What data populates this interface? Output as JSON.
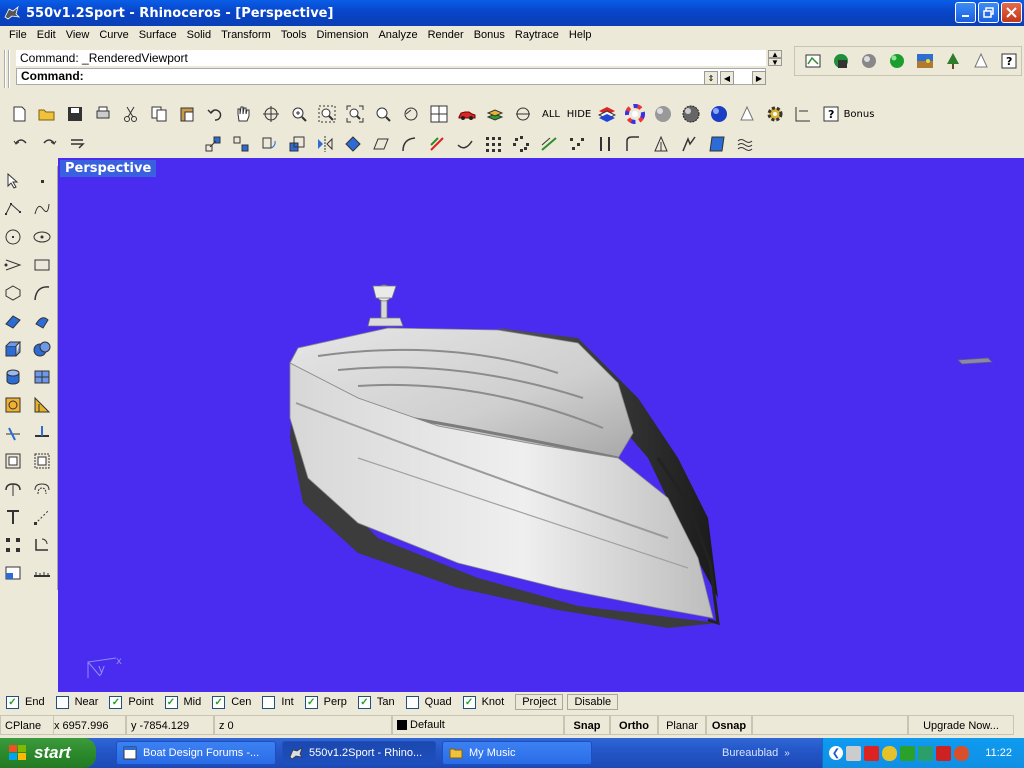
{
  "window": {
    "title": "550v1.2Sport - Rhinoceros - [Perspective]"
  },
  "menu": [
    "File",
    "Edit",
    "View",
    "Curve",
    "Surface",
    "Solid",
    "Transform",
    "Tools",
    "Dimension",
    "Analyze",
    "Render",
    "Bonus",
    "Raytrace",
    "Help"
  ],
  "command": {
    "history": "Command: _RenderedViewport",
    "prompt": "Command:"
  },
  "toolbar": {
    "all_label": "ALL",
    "hide_label": "HIDE",
    "bonus_label": "Bonus"
  },
  "viewport": {
    "label": "Perspective",
    "background": "#4a2bf0",
    "axis_y": "y",
    "axis_x": "x"
  },
  "osnap": {
    "items": [
      {
        "label": "End",
        "checked": true
      },
      {
        "label": "Near",
        "checked": false
      },
      {
        "label": "Point",
        "checked": true
      },
      {
        "label": "Mid",
        "checked": true
      },
      {
        "label": "Cen",
        "checked": true
      },
      {
        "label": "Int",
        "checked": false
      },
      {
        "label": "Perp",
        "checked": true
      },
      {
        "label": "Tan",
        "checked": true
      },
      {
        "label": "Quad",
        "checked": false
      },
      {
        "label": "Knot",
        "checked": true
      }
    ],
    "project_label": "Project",
    "disable_label": "Disable"
  },
  "status": {
    "cplane": "CPlane",
    "x": "x 6957.996",
    "y": "y -7854.129",
    "z": "z 0",
    "layer": "Default",
    "snap": "Snap",
    "ortho": "Ortho",
    "planar": "Planar",
    "osnap": "Osnap",
    "upgrade": "Upgrade Now..."
  },
  "taskbar": {
    "start_label": "start",
    "tasks": [
      {
        "label": "Boat Design Forums -...",
        "active": false
      },
      {
        "label": "550v1.2Sport - Rhino...",
        "active": true
      },
      {
        "label": "My Music",
        "active": false
      }
    ],
    "quick_launch": "Bureaublad",
    "clock": "11:22"
  }
}
